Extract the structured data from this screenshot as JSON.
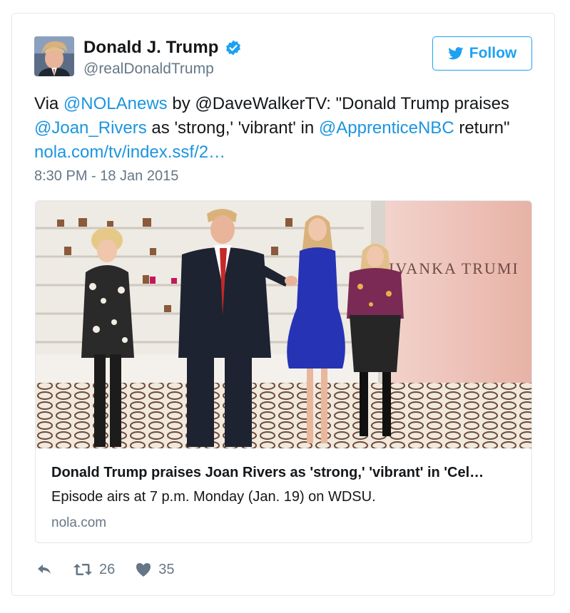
{
  "user": {
    "display_name": "Donald J. Trump",
    "handle": "@realDonaldTrump",
    "verified": true
  },
  "follow_button": {
    "label": "Follow",
    "icon": "twitter-bird-icon"
  },
  "tweet": {
    "segments": [
      {
        "text": "Via ",
        "link": false
      },
      {
        "text": "@NOLAnews",
        "link": true
      },
      {
        "text": " by @DaveWalkerTV: \"Donald Trump praises ",
        "link": false
      },
      {
        "text": "@Joan_Rivers",
        "link": true
      },
      {
        "text": " as 'strong,' 'vibrant' in ",
        "link": false
      },
      {
        "text": "@ApprenticeNBC",
        "link": true
      },
      {
        "text": " return\" ",
        "link": false
      },
      {
        "text": "nola.com/tv/index.ssf/2…",
        "link": true
      }
    ],
    "timestamp": "8:30 PM - 18 Jan 2015"
  },
  "card": {
    "image_sign_text": "IVANKA TRUMI",
    "title": "Donald Trump praises Joan Rivers as 'strong,' 'vibrant' in 'Cel…",
    "description": "Episode airs at 7 p.m. Monday (Jan. 19) on WDSU.",
    "domain": "nola.com"
  },
  "actions": {
    "reply": {
      "icon": "reply-icon"
    },
    "retweet": {
      "icon": "retweet-icon",
      "count": "26"
    },
    "like": {
      "icon": "heart-icon",
      "count": "35"
    }
  },
  "colors": {
    "link": "#1b95e0",
    "follow_accent": "#1da1f2",
    "muted": "#657786",
    "border": "#e1e8ed"
  }
}
